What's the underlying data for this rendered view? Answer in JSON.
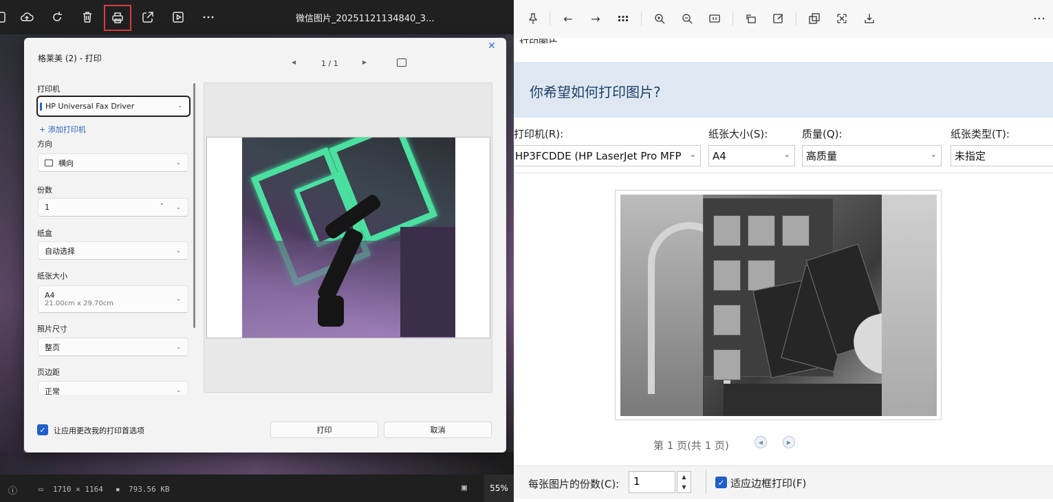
{
  "viewer": {
    "title": "微信图片_20251121134840_3...",
    "status": {
      "dimensions": "1710 × 1164",
      "filesize": "793.56 KB",
      "zoom": "55%"
    },
    "dialog": {
      "title": "格莱美 (2) - 打印",
      "close_glyph": "✕",
      "page_count": "1 / 1",
      "printer_label": "打印机",
      "printer_value": "HP Universal Fax Driver",
      "add_printer": "+ 添加打印机",
      "orientation_label": "方向",
      "orientation_value": "横向",
      "copies_label": "份数",
      "copies_value": "1",
      "tray_label": "纸盒",
      "tray_value": "自动选择",
      "paper_size_label": "纸张大小",
      "paper_size_value": "A4",
      "paper_size_detail": "21.00cm x 29.70cm",
      "photo_size_label": "照片尺寸",
      "photo_size_value": "整页",
      "margins_label": "页边距",
      "margins_value": "正常",
      "allow_app_label": "让应用更改我的打印首选项",
      "print_button": "打印",
      "cancel_button": "取消"
    }
  },
  "print_pictures": {
    "window_title": "打印图片",
    "heading": "你希望如何打印图片?",
    "printer_label": "打印机(R):",
    "printer_value": "HP3FCDDE (HP LaserJet Pro MFP",
    "paper_size_label": "纸张大小(S):",
    "paper_size_value": "A4",
    "quality_label": "质量(Q):",
    "quality_value": "高质量",
    "paper_type_label": "纸张类型(T):",
    "paper_type_value": "未指定",
    "page_indicator": "第 1 页(共 1 页)",
    "copies_label": "每张图片的份数(C):",
    "copies_value": "1",
    "fit_frame_label": "适应边框打印(F)"
  },
  "colors": {
    "accent_blue": "#1f5fc8",
    "highlight_red": "#e03c3c",
    "heading_band": "#dfe8f2"
  }
}
